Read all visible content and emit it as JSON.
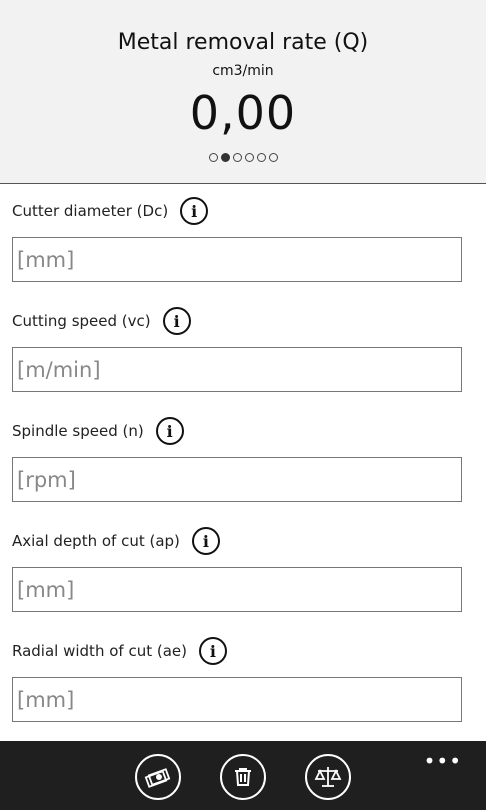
{
  "header": {
    "title": "Metal removal rate (Q)",
    "unit": "cm3/min",
    "result": "0,00",
    "page_indicator": {
      "total": 6,
      "active_index": 1
    }
  },
  "fields": [
    {
      "label": "Cutter diameter (Dc)",
      "placeholder": "[mm]",
      "value": ""
    },
    {
      "label": "Cutting speed (vc)",
      "placeholder": "[m/min]",
      "value": ""
    },
    {
      "label": "Spindle speed (n)",
      "placeholder": "[rpm]",
      "value": ""
    },
    {
      "label": "Axial depth of cut (ap)",
      "placeholder": "[mm]",
      "value": ""
    },
    {
      "label": "Radial width of cut (ae)",
      "placeholder": "[mm]",
      "value": ""
    }
  ],
  "info_glyph": "i",
  "app_bar": {
    "buttons": [
      "money-icon",
      "trash-icon",
      "scales-icon"
    ],
    "more": "•••"
  },
  "colors": {
    "header_bg": "#f2f2f2",
    "app_bar_bg": "#1f1f1f"
  }
}
